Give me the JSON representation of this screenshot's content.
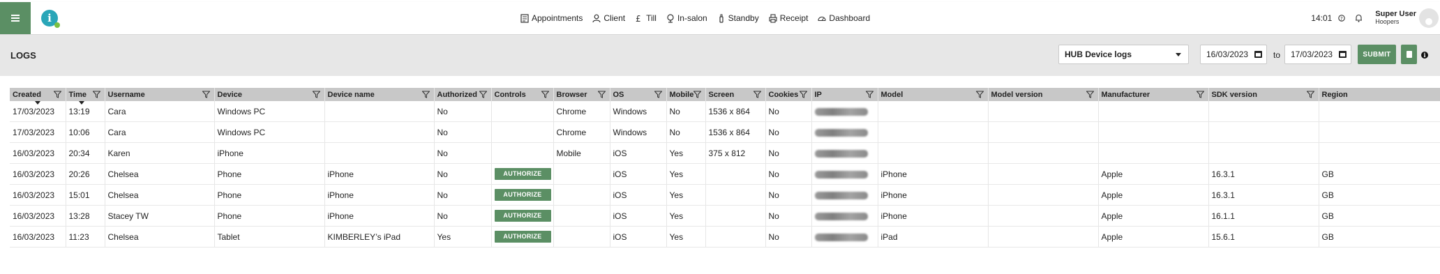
{
  "header": {
    "nav": [
      {
        "label": "Appointments",
        "icon": "calendar-icon"
      },
      {
        "label": "Client",
        "icon": "person-icon"
      },
      {
        "label": "Till",
        "icon": "pound-icon"
      },
      {
        "label": "In-salon",
        "icon": "dryer-icon"
      },
      {
        "label": "Standby",
        "icon": "bottle-icon"
      },
      {
        "label": "Receipt",
        "icon": "printer-icon"
      },
      {
        "label": "Dashboard",
        "icon": "gauge-icon"
      }
    ],
    "time": "14:01",
    "user_name": "Super User",
    "user_salon": "Hoopers"
  },
  "toolbar": {
    "title": "LOGS",
    "log_type": "HUB Device logs",
    "date_from": "16/03/2023",
    "to_label": "to",
    "date_to": "17/03/2023",
    "submit_label": "SUBMIT",
    "info_label": "i"
  },
  "table": {
    "columns": [
      "Created",
      "Time",
      "Username",
      "Device",
      "Device name",
      "Authorized",
      "Controls",
      "Browser",
      "OS",
      "Mobile",
      "Screen",
      "Cookies",
      "IP",
      "Model",
      "Model version",
      "Manufacturer",
      "SDK version",
      "Region"
    ],
    "authorize_label": "AUTHORIZE",
    "rows": [
      {
        "created": "17/03/2023",
        "time": "13:19",
        "username": "Cara",
        "device": "Windows PC",
        "device_name": "",
        "authorized": "No",
        "browser": "Chrome",
        "os": "Windows",
        "mobile": "No",
        "screen": "1536 x 864",
        "cookies": "No",
        "model": "",
        "model_version": "",
        "manufacturer": "",
        "sdk": "",
        "region": ""
      },
      {
        "created": "17/03/2023",
        "time": "10:06",
        "username": "Cara",
        "device": "Windows PC",
        "device_name": "",
        "authorized": "No",
        "browser": "Chrome",
        "os": "Windows",
        "mobile": "No",
        "screen": "1536 x 864",
        "cookies": "No",
        "model": "",
        "model_version": "",
        "manufacturer": "",
        "sdk": "",
        "region": ""
      },
      {
        "created": "16/03/2023",
        "time": "20:34",
        "username": "Karen",
        "device": "iPhone",
        "device_name": "",
        "authorized": "No",
        "browser": "Mobile",
        "os": "iOS",
        "mobile": "Yes",
        "screen": "375 x 812",
        "cookies": "No",
        "model": "",
        "model_version": "",
        "manufacturer": "",
        "sdk": "",
        "region": ""
      },
      {
        "created": "16/03/2023",
        "time": "20:26",
        "username": "Chelsea",
        "device": "Phone",
        "device_name": "iPhone",
        "authorized": "No",
        "browser": "",
        "os": "iOS",
        "mobile": "Yes",
        "screen": "",
        "cookies": "No",
        "model": "iPhone",
        "model_version": "",
        "manufacturer": "Apple",
        "sdk": "16.3.1",
        "region": "GB"
      },
      {
        "created": "16/03/2023",
        "time": "15:01",
        "username": "Chelsea",
        "device": "Phone",
        "device_name": "iPhone",
        "authorized": "No",
        "browser": "",
        "os": "iOS",
        "mobile": "Yes",
        "screen": "",
        "cookies": "No",
        "model": "iPhone",
        "model_version": "",
        "manufacturer": "Apple",
        "sdk": "16.3.1",
        "region": "GB"
      },
      {
        "created": "16/03/2023",
        "time": "13:28",
        "username": "Stacey TW",
        "device": "Phone",
        "device_name": "iPhone",
        "authorized": "No",
        "browser": "",
        "os": "iOS",
        "mobile": "Yes",
        "screen": "",
        "cookies": "No",
        "model": "iPhone",
        "model_version": "",
        "manufacturer": "Apple",
        "sdk": "16.1.1",
        "region": "GB"
      },
      {
        "created": "16/03/2023",
        "time": "11:23",
        "username": "Chelsea",
        "device": "Tablet",
        "device_name": "KIMBERLEY’s iPad",
        "authorized": "Yes",
        "browser": "",
        "os": "iOS",
        "mobile": "Yes",
        "screen": "",
        "cookies": "No",
        "model": "iPad",
        "model_version": "",
        "manufacturer": "Apple",
        "sdk": "15.6.1",
        "region": "GB"
      }
    ]
  },
  "colors": {
    "accent": "#5b8f64",
    "header_bg": "#c8c8c8",
    "subbar_bg": "#e7e7e7"
  }
}
